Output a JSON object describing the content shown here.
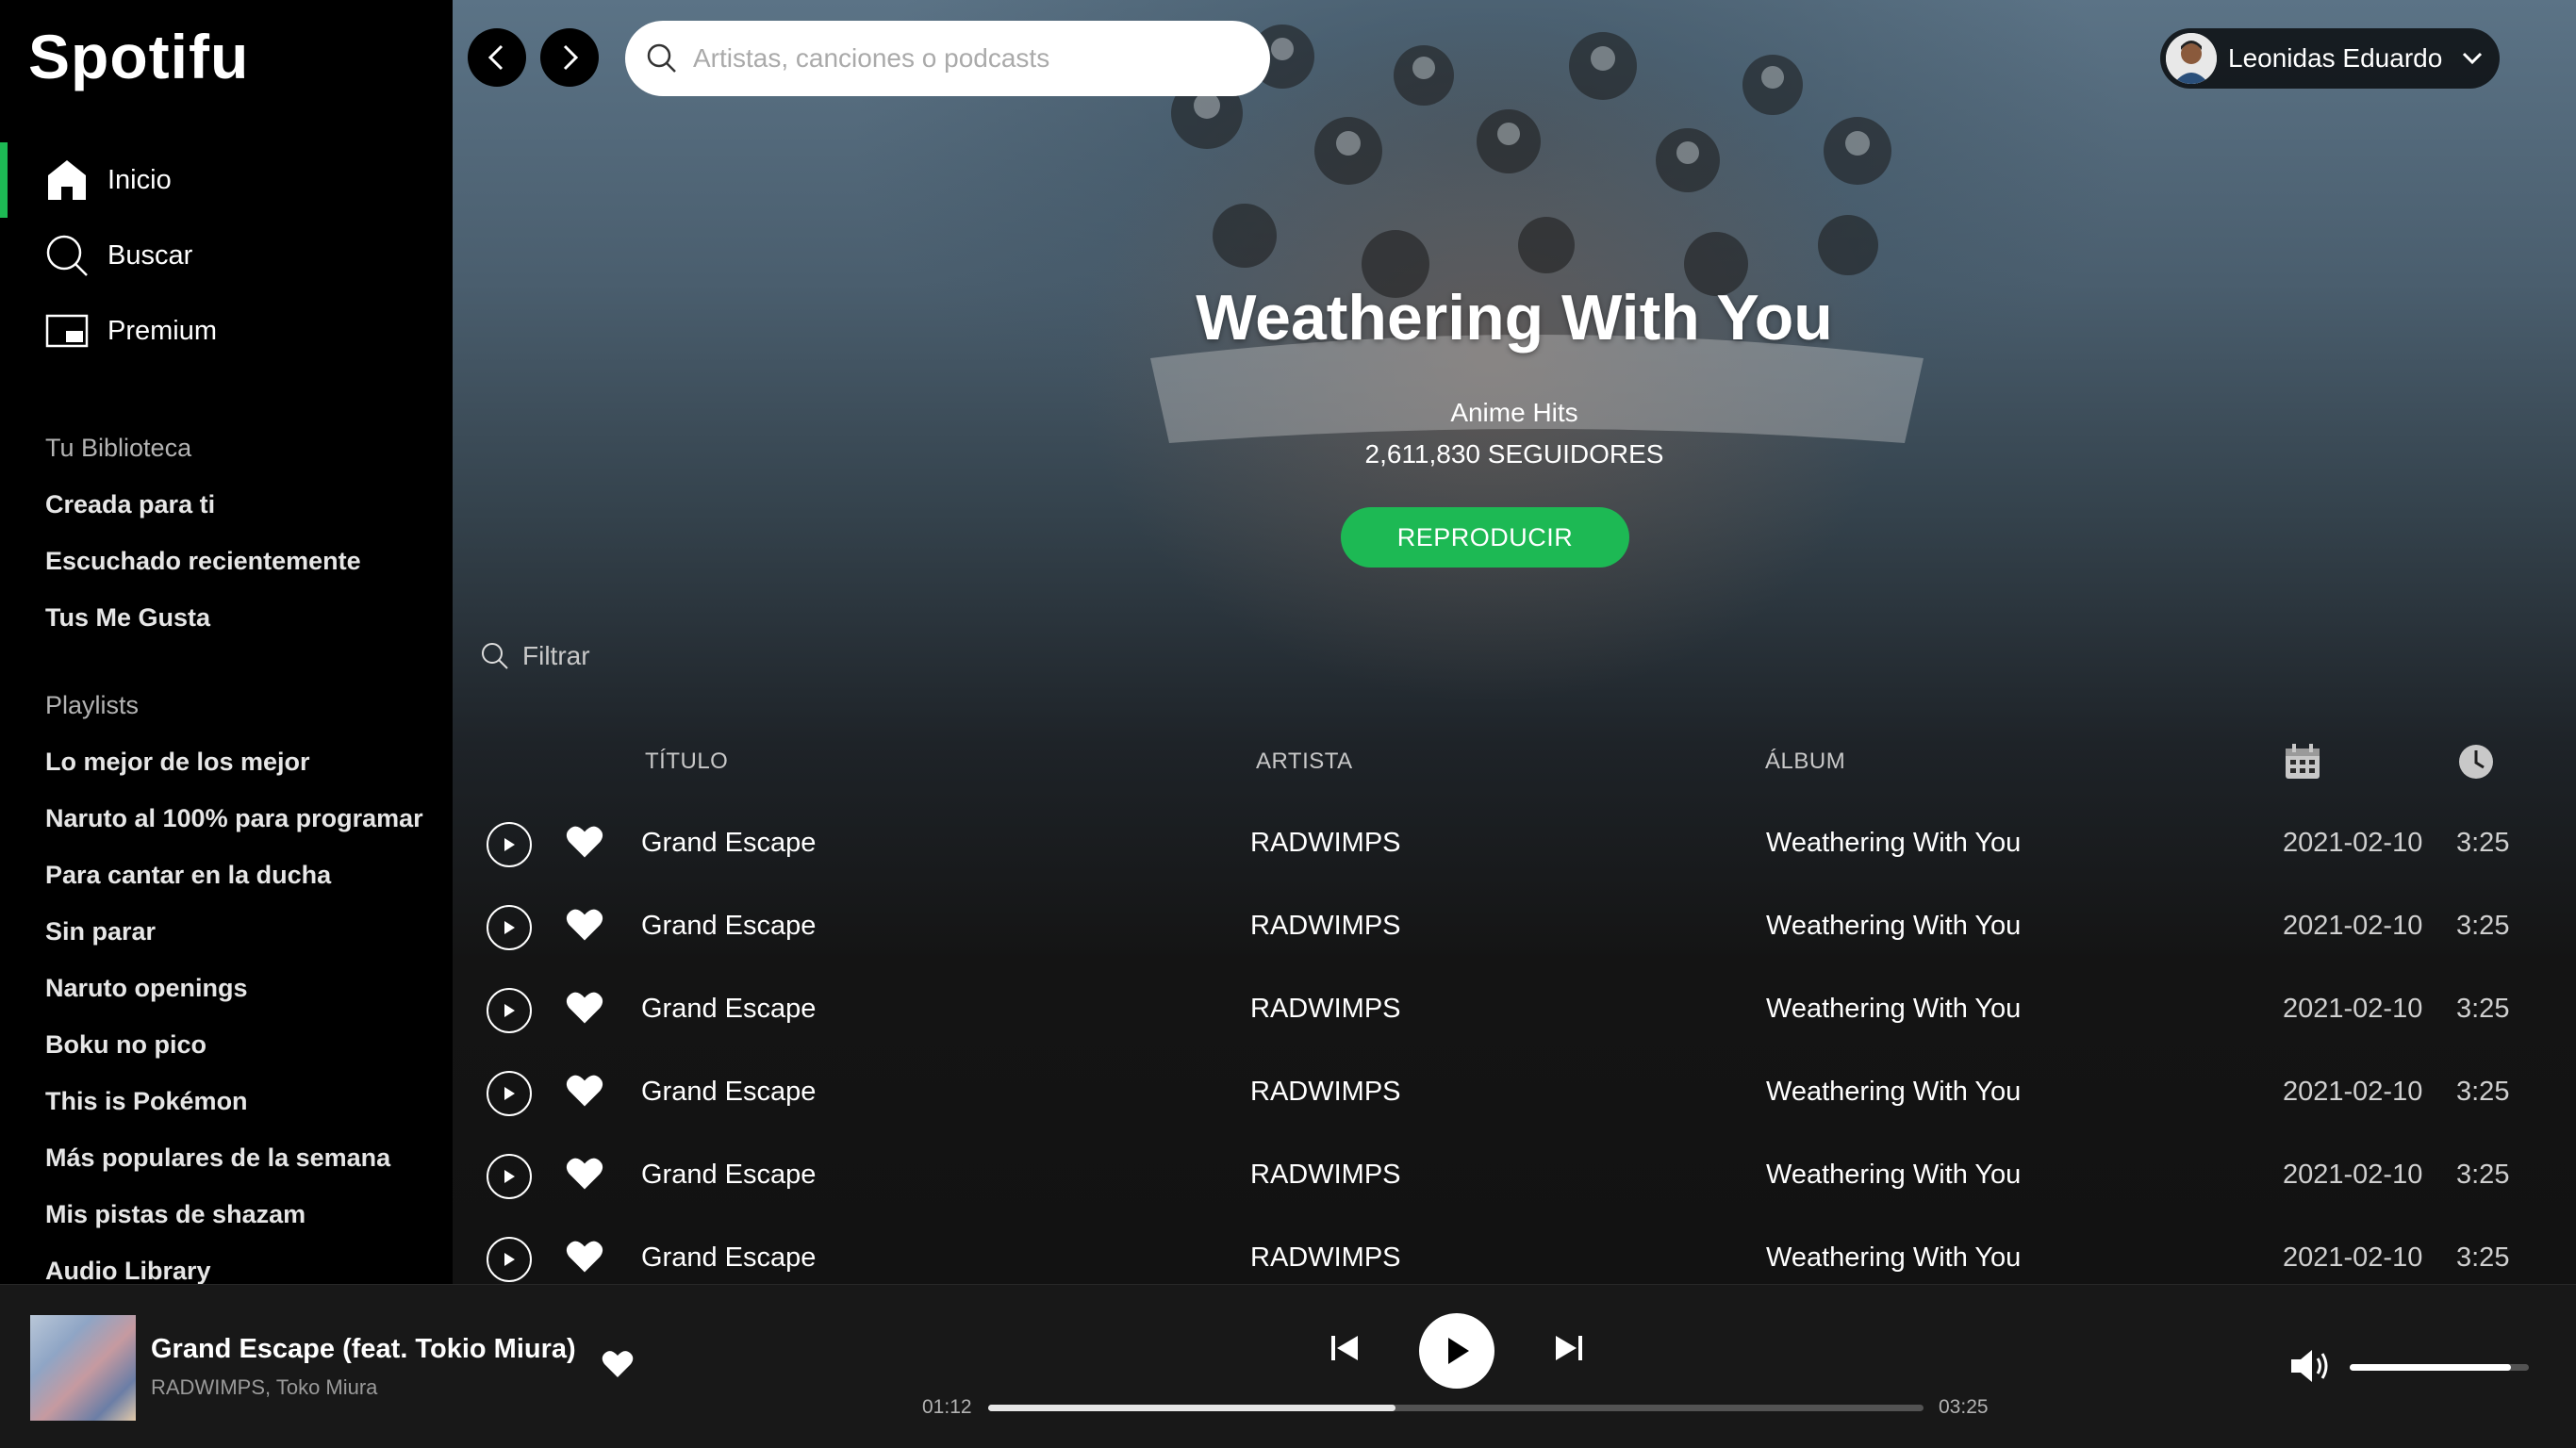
{
  "app": {
    "logo": "Spotifu"
  },
  "sidebar": {
    "nav": [
      {
        "label": "Inicio",
        "icon": "home-icon",
        "active": true
      },
      {
        "label": "Buscar",
        "icon": "search-icon",
        "active": false
      },
      {
        "label": "Premium",
        "icon": "premium-icon",
        "active": false
      }
    ],
    "library_title": "Tu Biblioteca",
    "library": [
      "Creada para ti",
      "Escuchado recientemente",
      "Tus Me Gusta"
    ],
    "playlists_title": "Playlists",
    "playlists": [
      "Lo mejor de los mejor",
      "Naruto al 100% para programar",
      "Para cantar en la ducha",
      "Sin parar",
      "Naruto openings",
      "Boku no pico",
      "This is Pokémon",
      "Más populares de la semana",
      "Mis pistas de shazam",
      "Audio Library"
    ]
  },
  "topbar": {
    "search_placeholder": "Artistas, canciones o podcasts",
    "user_name": "Leonidas Eduardo"
  },
  "hero": {
    "title": "Weathering With You",
    "subtitle": "Anime Hits",
    "followers": "2,611,830 SEGUIDORES",
    "play_label": "REPRODUCIR"
  },
  "filter": {
    "placeholder": "Filtrar"
  },
  "table": {
    "headers": {
      "title": "TÍTULO",
      "artist": "ARTISTA",
      "album": "ÁLBUM"
    },
    "rows": [
      {
        "title": "Grand Escape",
        "artist": "RADWIMPS",
        "album": "Weathering With You",
        "date": "2021-02-10",
        "duration": "3:25"
      },
      {
        "title": "Grand Escape",
        "artist": "RADWIMPS",
        "album": "Weathering With You",
        "date": "2021-02-10",
        "duration": "3:25"
      },
      {
        "title": "Grand Escape",
        "artist": "RADWIMPS",
        "album": "Weathering With You",
        "date": "2021-02-10",
        "duration": "3:25"
      },
      {
        "title": "Grand Escape",
        "artist": "RADWIMPS",
        "album": "Weathering With You",
        "date": "2021-02-10",
        "duration": "3:25"
      },
      {
        "title": "Grand Escape",
        "artist": "RADWIMPS",
        "album": "Weathering With You",
        "date": "2021-02-10",
        "duration": "3:25"
      },
      {
        "title": "Grand Escape",
        "artist": "RADWIMPS",
        "album": "Weathering With You",
        "date": "2021-02-10",
        "duration": "3:25"
      }
    ]
  },
  "player": {
    "title": "Grand Escape (feat. Tokio Miura)",
    "artist": "RADWIMPS, Toko Miura",
    "elapsed": "01:12",
    "total": "03:25",
    "progress_fraction": 0.435,
    "volume_fraction": 0.9
  },
  "colors": {
    "accent": "#1db954",
    "sidebar_bg": "#000000",
    "player_bg": "#181818"
  }
}
